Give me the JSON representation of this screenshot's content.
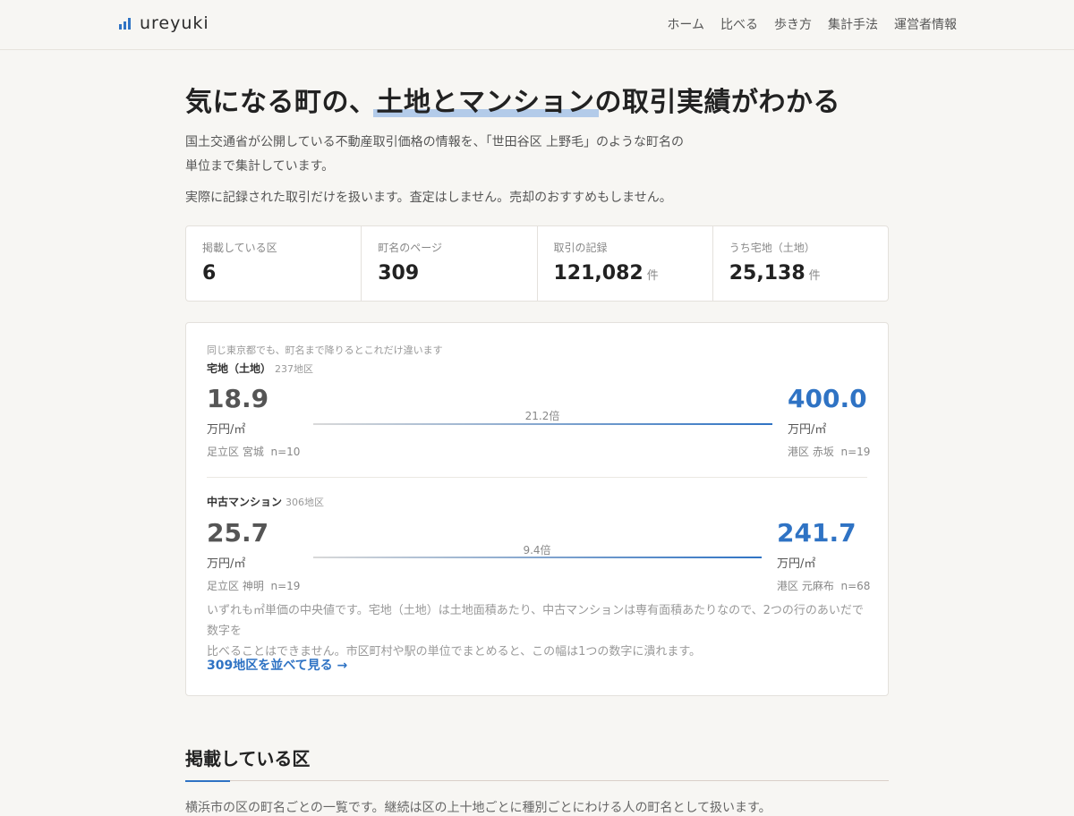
{
  "header": {
    "brand": "ureyuki",
    "nav": [
      "ホーム",
      "比べる",
      "歩き方",
      "集計手法",
      "運営者情報"
    ]
  },
  "hero": {
    "title_before": "気になる町の、",
    "title_highlight": "土地とマンション",
    "title_after": "の取引実績がわかる",
    "lead_line1": "国土交通省が公開している不動産取引価格の情報を、「世田谷区 上野毛」のような町名の",
    "lead_line2": "単位まで集計しています。",
    "lead2": "実際に記録された取引だけを扱います。査定はしません。売却のおすすめもしません。"
  },
  "stats": [
    {
      "label": "掲載している区",
      "value": "6",
      "unit": ""
    },
    {
      "label": "町名のページ",
      "value": "309",
      "unit": ""
    },
    {
      "label": "取引の記録",
      "value": "121,082",
      "unit": "件"
    },
    {
      "label": "うち宅地（土地）",
      "value": "25,138",
      "unit": "件"
    }
  ],
  "compare": {
    "caption": "同じ東京都でも、町名まで降りるとこれだけ違います",
    "rows": [
      {
        "title": "宅地（土地）",
        "count": "237地区",
        "low": {
          "value": "18.9",
          "unit": "万円/㎡",
          "place": "足立区 宮城",
          "n": "n=10"
        },
        "high": {
          "value": "400.0",
          "unit": "万円/㎡",
          "place": "港区 赤坂",
          "n": "n=19"
        },
        "ratio": "21.2倍"
      },
      {
        "title": "中古マンション",
        "count": "306地区",
        "low": {
          "value": "25.7",
          "unit": "万円/㎡",
          "place": "足立区 神明",
          "n": "n=19"
        },
        "high": {
          "value": "241.7",
          "unit": "万円/㎡",
          "place": "港区 元麻布",
          "n": "n=68"
        },
        "ratio": "9.4倍"
      }
    ],
    "note_line1": "いずれも㎡単価の中央値です。宅地（土地）は土地面積あたり、中古マンションは専有面積あたりなので、2つの行のあいだで数字を",
    "note_line2": "比べることはできません。市区町村や駅の単位でまとめると、この幅は1つの数字に潰れます。",
    "link": "309地区を並べて見る →"
  },
  "section": {
    "title": "掲載している区",
    "body": "横浜市の区の町名ごとの一覧です。継続は区の上十地ごとに種別ごとにわける人の町名として扱います。"
  },
  "colors": {
    "accent": "#2f73c4",
    "highlight": "#a7c3e6"
  }
}
